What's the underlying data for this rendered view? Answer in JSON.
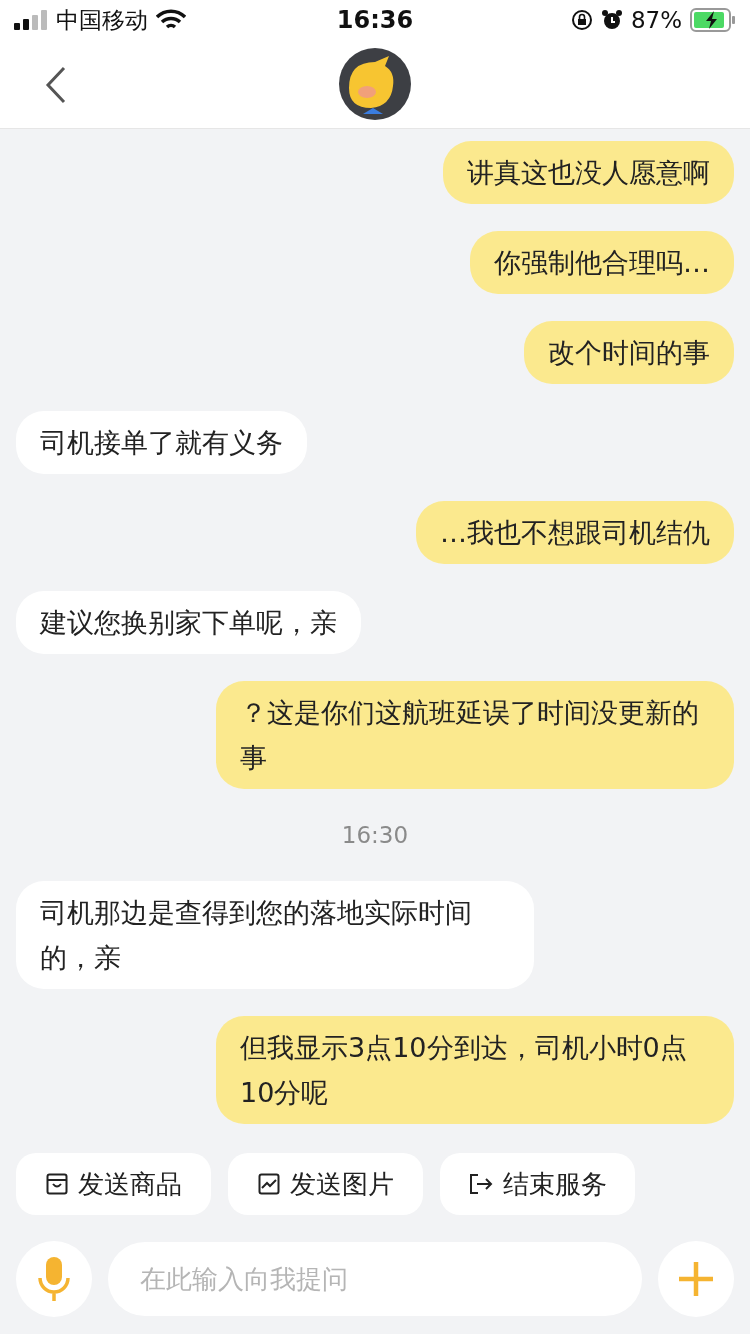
{
  "status_bar": {
    "carrier": "中国移动",
    "time": "16:36",
    "battery": "87%"
  },
  "messages": [
    {
      "kind": "outgoing",
      "text": "讲真这也没人愿意啊"
    },
    {
      "kind": "outgoing",
      "text": "你强制他合理吗…"
    },
    {
      "kind": "outgoing",
      "text": "改个时间的事"
    },
    {
      "kind": "incoming",
      "text": "司机接单了就有义务"
    },
    {
      "kind": "outgoing",
      "text": "…我也不想跟司机结仇"
    },
    {
      "kind": "incoming",
      "text": "建议您换别家下单呢，亲"
    },
    {
      "kind": "outgoing",
      "text": "？这是你们这航班延误了时间没更新的事"
    },
    {
      "kind": "time",
      "text": "16:30"
    },
    {
      "kind": "incoming",
      "text": "司机那边是查得到您的落地实际时间的，亲"
    },
    {
      "kind": "outgoing",
      "text": "但我显示3点10分到达，司机小时0点10分呢"
    }
  ],
  "quick_actions": [
    {
      "kind": "product",
      "label": "发送商品"
    },
    {
      "kind": "image",
      "label": "发送图片"
    },
    {
      "kind": "end",
      "label": "结束服务"
    }
  ],
  "input": {
    "placeholder": "在此输入向我提问"
  }
}
